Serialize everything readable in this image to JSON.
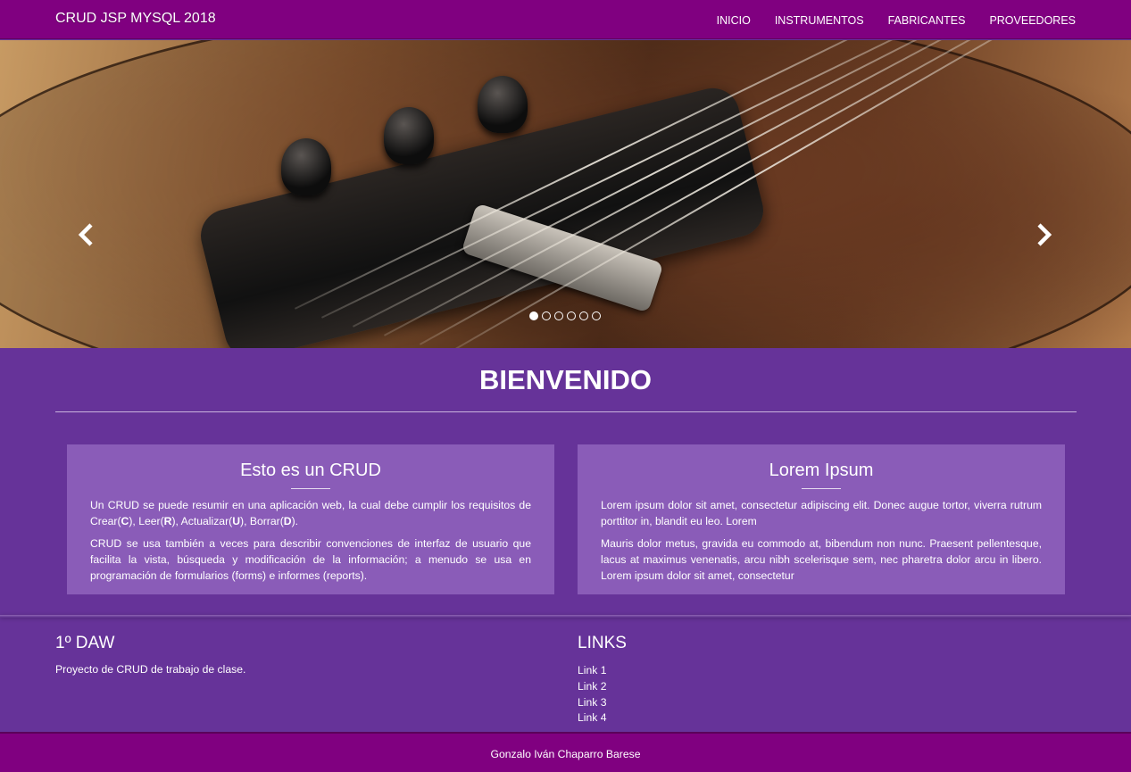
{
  "navbar": {
    "brand": "CRUD JSP MYSQL 2018",
    "items": [
      {
        "label": "INICIO"
      },
      {
        "label": "INSTRUMENTOS"
      },
      {
        "label": "FABRICANTES"
      },
      {
        "label": "PROVEEDORES"
      }
    ]
  },
  "carousel": {
    "prev_icon": "chevron-left-icon",
    "next_icon": "chevron-right-icon",
    "slides": 6,
    "active_slide": 1
  },
  "welcome": {
    "title": "BIENVENIDO"
  },
  "cards": [
    {
      "title": "Esto es un CRUD",
      "paragraphs": [
        "Un CRUD se puede resumir en una aplicación web, la cual debe cumplir los requisitos de Crear(C), Leer(R), Actualizar(U), Borrar(D).",
        "CRUD se usa también a veces para describir convenciones de interfaz de usuario que facilita la vista, búsqueda y modificación de la información; a menudo se usa en programación de formularios (forms) e informes (reports)."
      ]
    },
    {
      "title": "Lorem Ipsum",
      "paragraphs": [
        "Lorem ipsum dolor sit amet, consectetur adipiscing elit. Donec augue tortor, viverra rutrum porttitor in, blandit eu leo. Lorem",
        "Mauris dolor metus, gravida eu commodo at, bibendum non nunc. Praesent pellentesque, lacus at maximus venenatis, arcu nibh scelerisque sem, nec pharetra dolor arcu in libero. Lorem ipsum dolor sit amet, consectetur"
      ]
    }
  ],
  "footer": {
    "left_title": "1º DAW",
    "left_desc": "Proyecto de CRUD de trabajo de clase.",
    "right_title": "LINKS",
    "links": [
      {
        "label": "Link 1"
      },
      {
        "label": "Link 2"
      },
      {
        "label": "Link 3"
      },
      {
        "label": "Link 4"
      }
    ],
    "author": "Gonzalo Iván Chaparro Barese"
  },
  "colors": {
    "navbar": "#800080",
    "background": "#663399",
    "card": "#8a5cb8"
  }
}
